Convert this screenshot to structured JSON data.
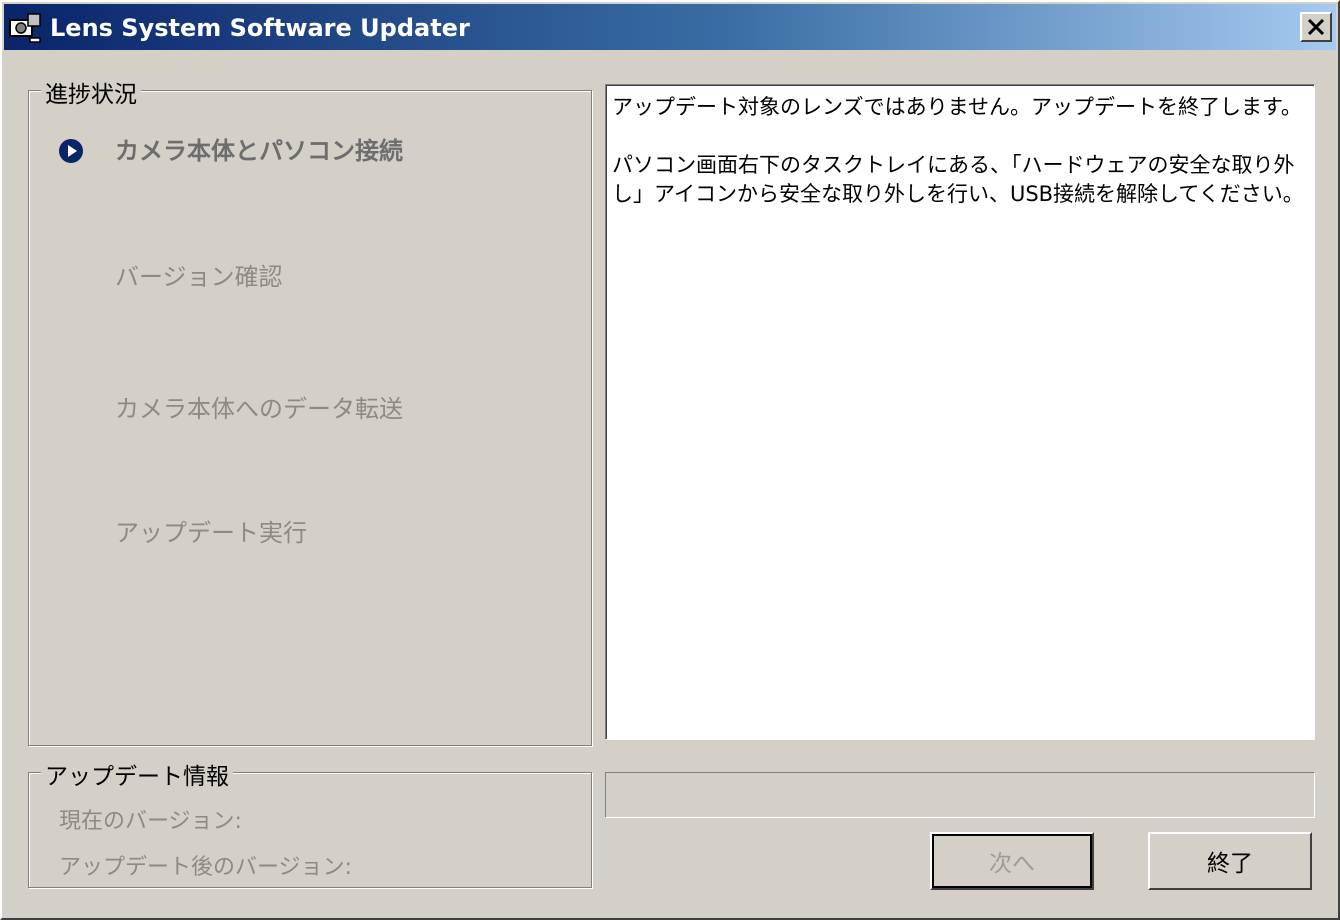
{
  "window": {
    "title": "Lens System Software Updater",
    "close_label": "×"
  },
  "progress": {
    "group_label": "進捗状況",
    "current_step": 0,
    "steps": [
      "カメラ本体とパソコン接続",
      "バージョン確認",
      "カメラ本体へのデータ転送",
      "アップデート実行"
    ]
  },
  "message": {
    "line1": "アップデート対象のレンズではありません。アップデートを終了します。",
    "line2": "パソコン画面右下のタスクトレイにある、「ハードウェアの安全な取り外し」アイコンから安全な取り外しを行い、USB接続を解除してください。"
  },
  "update_info": {
    "group_label": "アップデート情報",
    "current_version_label": "現在のバージョン:",
    "after_version_label": "アップデート後のバージョン:"
  },
  "progress_bar": {
    "value": 0
  },
  "buttons": {
    "next_label": "次へ",
    "exit_label": "終了"
  },
  "colors": {
    "titlebar_start": "#0a246a",
    "titlebar_end": "#a6caf0",
    "step_marker": "#0a246a"
  },
  "icons": {
    "app": "camera-updater-icon",
    "close": "close-icon",
    "step_marker": "play-circle-icon"
  }
}
